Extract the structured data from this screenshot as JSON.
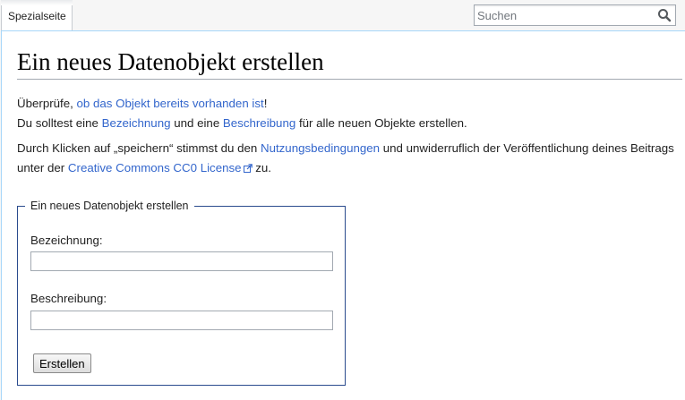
{
  "tabs": {
    "special_page": "Spezialseite"
  },
  "search": {
    "placeholder": "Suchen",
    "icon": "search-icon"
  },
  "page": {
    "title": "Ein neues Datenobjekt erstellen",
    "intro": {
      "check_prefix": "Überprüfe, ",
      "check_link": "ob das Objekt bereits vorhanden ist",
      "check_suffix": "!",
      "line2_prefix": "Du solltest eine ",
      "label_link": "Bezeichnung",
      "line2_middle": " und eine ",
      "description_link": "Beschreibung",
      "line2_suffix": " für alle neuen Objekte erstellen."
    },
    "terms": {
      "prefix": "Durch Klicken auf „speichern“ stimmst du den ",
      "terms_link": "Nutzungsbedingungen",
      "middle": " und unwiderruflich der Veröffentlichung deines Beitrags unter der ",
      "license_link": "Creative Commons CC0 License",
      "suffix": " zu.",
      "external_icon": "external-link-icon"
    }
  },
  "form": {
    "legend": "Ein neues Datenobjekt erstellen",
    "label_field": {
      "label": "Bezeichnung:",
      "value": ""
    },
    "description_field": {
      "label": "Beschreibung:",
      "value": ""
    },
    "submit_label": "Erstellen"
  },
  "colors": {
    "link": "#3366cc",
    "content_border": "#a7d7f9",
    "fieldset_border": "#2a4b8d",
    "page_background": "#f6f6f6"
  }
}
